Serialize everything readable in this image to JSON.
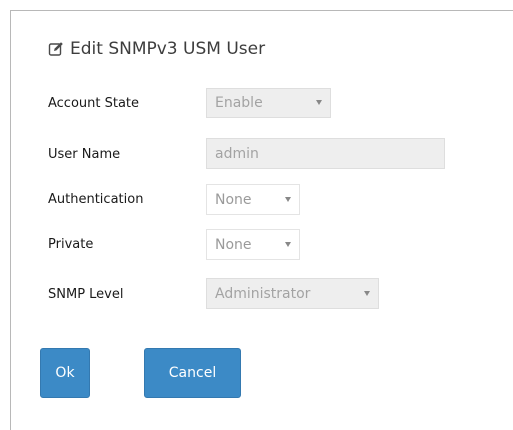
{
  "dialog": {
    "title": "Edit SNMPv3 USM User",
    "title_icon": "edit-icon"
  },
  "fields": {
    "account_state": {
      "label": "Account State",
      "value": "Enable",
      "disabled": true
    },
    "user_name": {
      "label": "User Name",
      "value": "admin",
      "disabled": true
    },
    "authentication": {
      "label": "Authentication",
      "value": "None",
      "disabled": false
    },
    "private": {
      "label": "Private",
      "value": "None",
      "disabled": false
    },
    "snmp_level": {
      "label": "SNMP Level",
      "value": "Administrator",
      "disabled": true
    }
  },
  "buttons": {
    "ok_label": "Ok",
    "cancel_label": "Cancel"
  },
  "colors": {
    "button_bg": "#3c8ac6",
    "disabled_bg": "#eeeeee"
  }
}
